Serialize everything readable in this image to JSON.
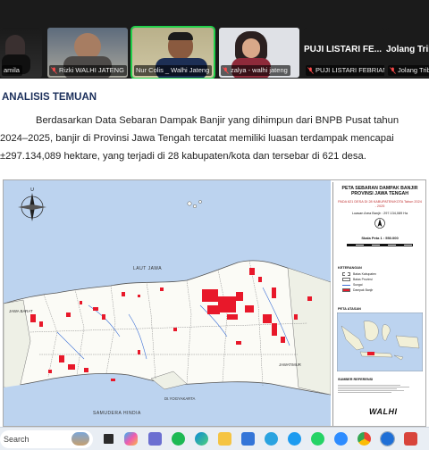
{
  "participants": [
    {
      "name": "amila",
      "muted": true
    },
    {
      "name": "Rizki WALHI JATENG",
      "muted": true
    },
    {
      "name": "Nur Colis _ Walhi Jateng",
      "muted": false,
      "active_speaker": true
    },
    {
      "name": "zalya - walhi jateng",
      "muted": true
    },
    {
      "name": "PUJI LISTARI FEBRIANA",
      "muted": true,
      "header": "PUJI LISTARI FE..."
    },
    {
      "name": "Jolang Tribuana",
      "muted": true,
      "header": "Jolang Tribu"
    }
  ],
  "slide": {
    "heading": "ANALISIS TEMUAN",
    "paragraph_line1": "Berdasarkan Data Sebaran Dampak Banjir yang dihimpun dari BNPB Pusat tahun",
    "paragraph_line2": "2024–2025, banjir di Provinsi Jawa Tengah tercatat memiliki luasan terdampak mencapai",
    "paragraph_line3": "±297.134,089 hektare, yang terjadi di 28 kabupaten/kota dan tersebar di 621 desa."
  },
  "map": {
    "labels": {
      "laut_jawa": "LAUT JAWA",
      "jawa_barat": "JAWA BARAT",
      "jawa_timur": "JAWATIMUR",
      "diy": "DI.YOGYAKARTA",
      "samudera": "SAMUDERA HINDIA"
    },
    "legend": {
      "title": "PETA SEBARAN DAMPAK BANJIR PROVINSI JAWA TENGAH",
      "subtitle": "PADA 621 DESA DI 28 KABUPATEN/KOTA Tahun 2024 - 2025",
      "area": "Luasan Area Banjir : 297.134,089 Ha",
      "scale": "Skala Peta 1 : 550.000",
      "keterangan": "KETERANGAN",
      "items": [
        "Batas Kabupaten",
        "Batas Provinsi",
        "Sungai",
        "Dampak Banjir"
      ],
      "inset_label": "PETA ATASAN",
      "sumber": "SUMBER REFERENSI",
      "org": "WALHI",
      "colors": {
        "flood": "#e8182a",
        "water": "#bcd3ef",
        "land": "#fbfbf6",
        "river": "#3b6fd6",
        "border": "#555555"
      }
    }
  },
  "taskbar": {
    "search_label": "Search"
  }
}
